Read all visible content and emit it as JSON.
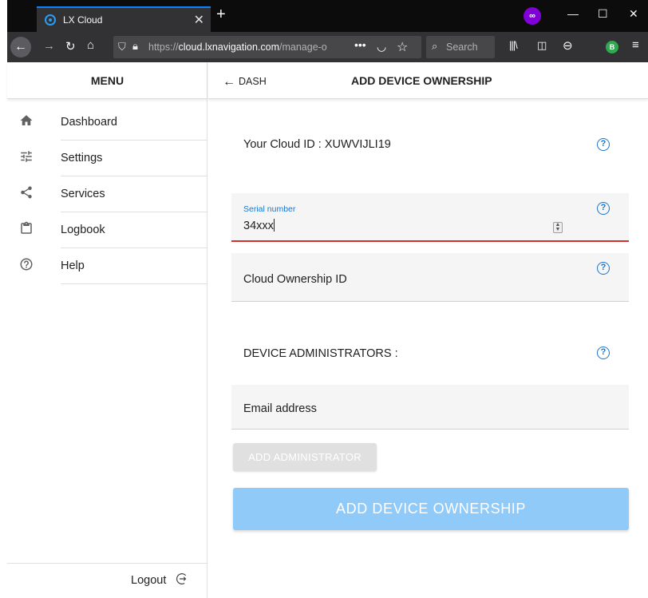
{
  "browser": {
    "tab_title": "LX Cloud",
    "url_host": "cloud.lxnavigation.com",
    "url_prefix": "https://",
    "url_path": "/manage-o",
    "search_placeholder": "Search"
  },
  "sidebar": {
    "header": "MENU",
    "items": [
      {
        "label": "Dashboard",
        "icon": "home-icon"
      },
      {
        "label": "Settings",
        "icon": "sliders-icon"
      },
      {
        "label": "Services",
        "icon": "share-icon"
      },
      {
        "label": "Logbook",
        "icon": "clipboard-icon"
      },
      {
        "label": "Help",
        "icon": "help-circle-icon"
      }
    ],
    "logout": "Logout"
  },
  "topbar": {
    "back_label": "DASH",
    "title": "ADD DEVICE OWNERSHIP"
  },
  "form": {
    "cloud_id_text": "Your Cloud ID : XUWVIJLI19",
    "serial_label": "Serial number",
    "serial_value": "34xxx",
    "ownership_placeholder": "Cloud Ownership ID",
    "admins_heading": "DEVICE ADMINISTRATORS :",
    "email_placeholder": "Email address",
    "add_admin_button": "ADD ADMINISTRATOR",
    "add_ownership_button": "ADD DEVICE OWNERSHIP"
  },
  "colors": {
    "accent": "#1976d2",
    "error_underline": "#d32f2f",
    "primary_button_disabled": "#90caf9"
  }
}
